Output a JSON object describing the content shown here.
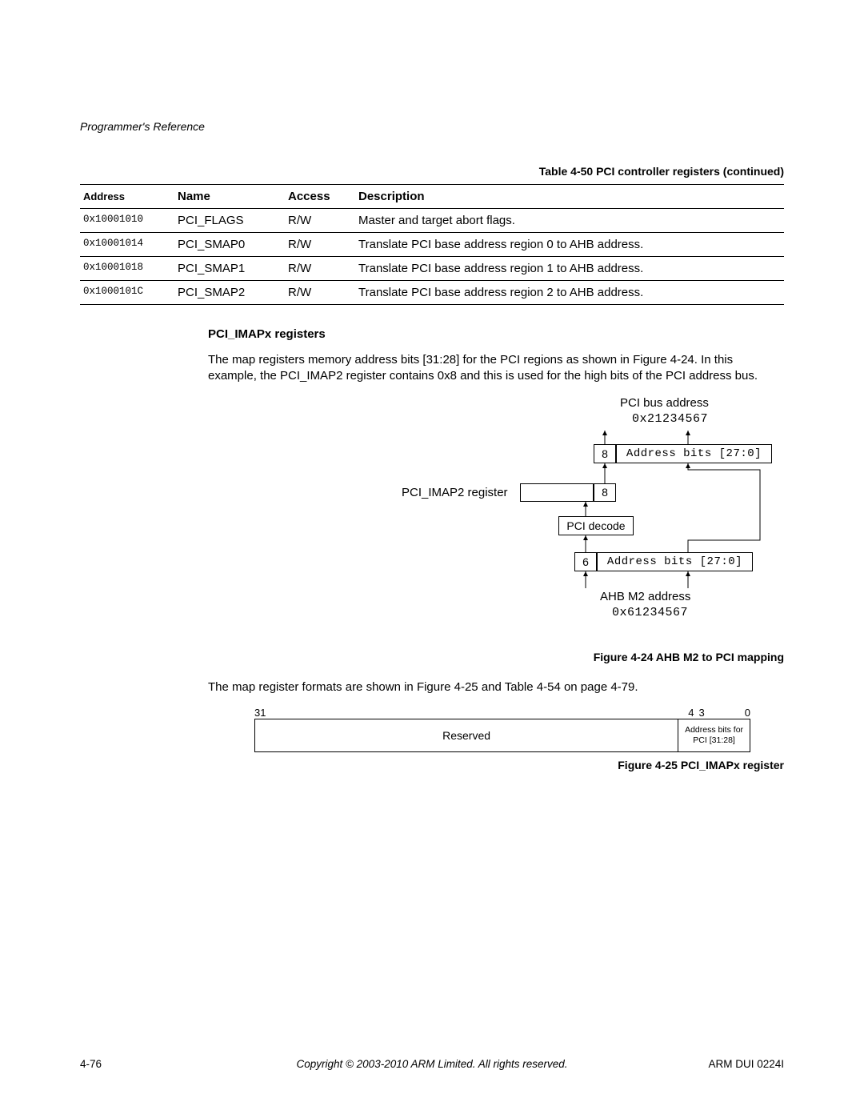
{
  "running_head": "Programmer's Reference",
  "table_caption": "Table 4-50 PCI controller registers (continued)",
  "table": {
    "headers": [
      "Address",
      "Name",
      "Access",
      "Description"
    ],
    "rows": [
      {
        "address": "0x10001010",
        "name": "PCI_FLAGS",
        "access": "R/W",
        "desc": "Master and target abort flags."
      },
      {
        "address": "0x10001014",
        "name": "PCI_SMAP0",
        "access": "R/W",
        "desc": "Translate PCI base address region 0 to AHB address."
      },
      {
        "address": "0x10001018",
        "name": "PCI_SMAP1",
        "access": "R/W",
        "desc": "Translate PCI base address region 1 to AHB address."
      },
      {
        "address": "0x1000101C",
        "name": "PCI_SMAP2",
        "access": "R/W",
        "desc": "Translate PCI base address region 2 to AHB address."
      }
    ]
  },
  "section": {
    "heading": "PCI_IMAPx registers",
    "para1": "The map registers memory address bits [31:28] for the PCI regions as shown in Figure 4-24. In this example, the PCI_IMAP2 register contains 0x8 and this is used for the high bits of the PCI address bus.",
    "para2": "The map register formats are shown in Figure 4-25 and Table 4-54 on page 4-79."
  },
  "fig24": {
    "pci_bus_label": "PCI bus address",
    "pci_bus_value": "0x21234567",
    "top_nibble": "8",
    "top_addr_bits": "Address bits [27:0]",
    "imap_label": "PCI_IMAP2 register",
    "imap_value": "8",
    "pci_decode": "PCI decode",
    "bot_nibble": "6",
    "bot_addr_bits": "Address bits [27:0]",
    "ahb_label": "AHB M2 address",
    "ahb_value": "0x61234567",
    "caption": "Figure 4-24 AHB M2 to PCI mapping"
  },
  "fig25": {
    "bit_hi": "31",
    "bit_mid_hi": "4",
    "bit_mid_lo": "3",
    "bit_lo": "0",
    "reserved": "Reserved",
    "addrbits": "Address bits for PCI [31:28]",
    "caption": "Figure 4-25 PCI_IMAPx register"
  },
  "footer": {
    "left": "4-76",
    "mid": "Copyright © 2003-2010 ARM Limited. All rights reserved.",
    "right": "ARM DUI 0224I"
  }
}
